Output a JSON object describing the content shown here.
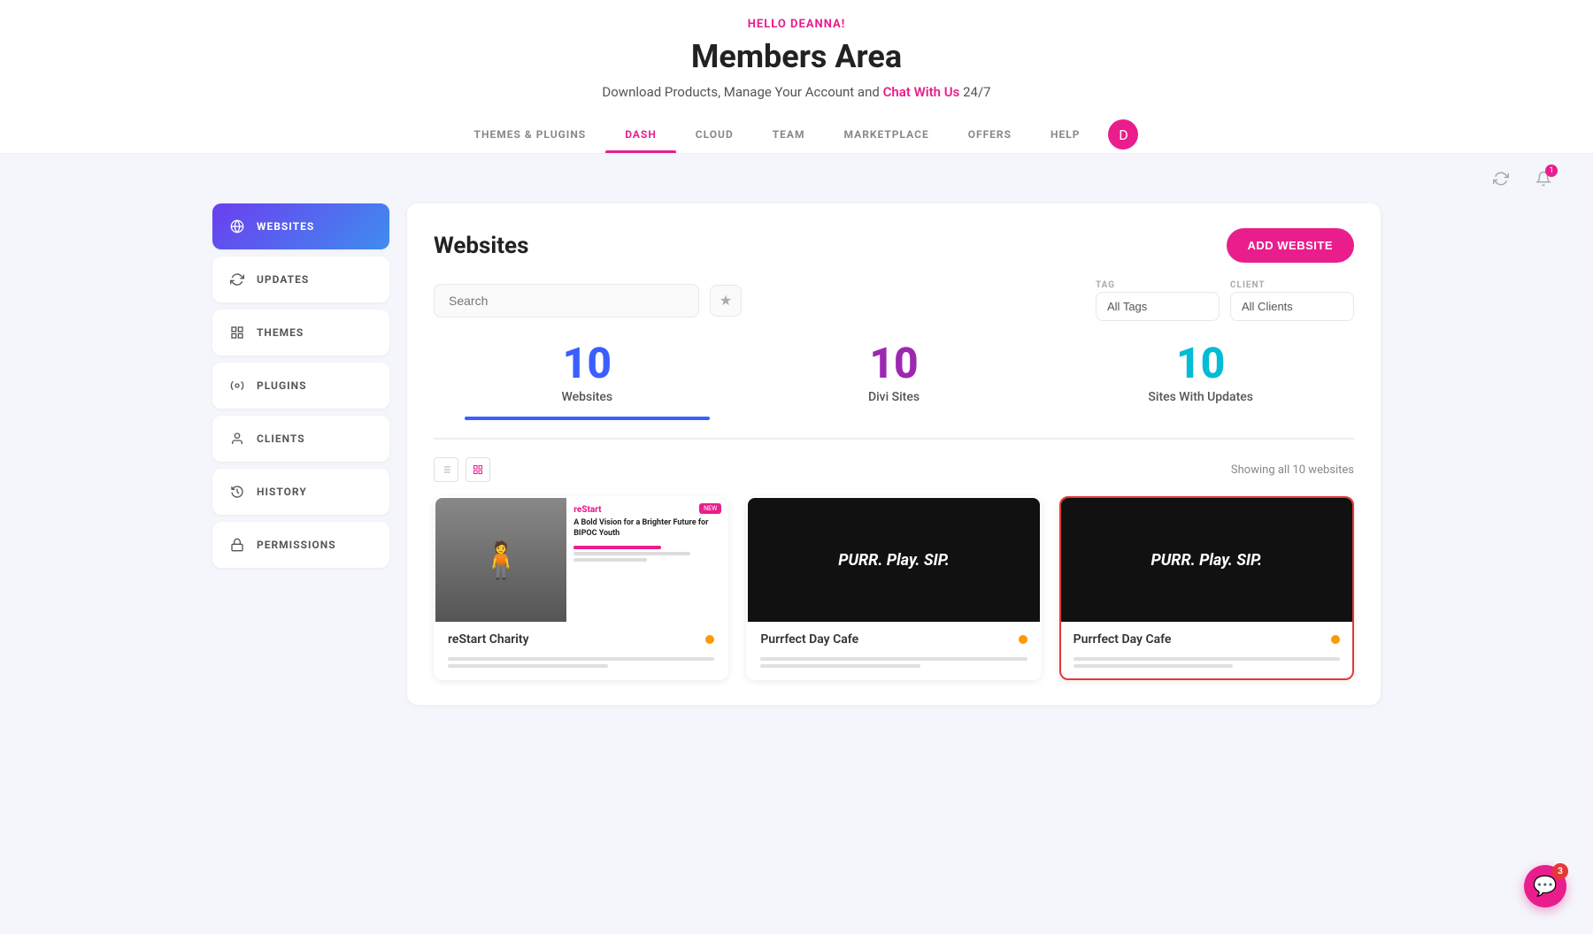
{
  "header": {
    "hello_text": "HELLO DEANNA!",
    "title": "Members Area",
    "subtitle_text": "Download Products, Manage Your Account and",
    "subtitle_link": "Chat With Us",
    "subtitle_suffix": " 24/7"
  },
  "nav": {
    "items": [
      {
        "id": "themes-plugins",
        "label": "THEMES & PLUGINS",
        "active": false
      },
      {
        "id": "dash",
        "label": "DASH",
        "active": true
      },
      {
        "id": "cloud",
        "label": "CLOUD",
        "active": false
      },
      {
        "id": "team",
        "label": "TEAM",
        "active": false
      },
      {
        "id": "marketplace",
        "label": "MARKETPLACE",
        "active": false
      },
      {
        "id": "offers",
        "label": "OFFERS",
        "active": false
      },
      {
        "id": "help",
        "label": "HELP",
        "active": false
      }
    ],
    "avatar_letter": "D"
  },
  "toolbar": {
    "refresh_tooltip": "Refresh",
    "notifications_count": "1"
  },
  "sidebar": {
    "items": [
      {
        "id": "websites",
        "label": "WEBSITES",
        "icon": "globe",
        "active": true
      },
      {
        "id": "updates",
        "label": "UPDATES",
        "icon": "refresh",
        "active": false
      },
      {
        "id": "themes",
        "label": "THEMES",
        "icon": "grid",
        "active": false
      },
      {
        "id": "plugins",
        "label": "PLUGINS",
        "icon": "puzzle",
        "active": false
      },
      {
        "id": "clients",
        "label": "CLIENTS",
        "icon": "person",
        "active": false
      },
      {
        "id": "history",
        "label": "HISTORY",
        "icon": "clock",
        "active": false
      },
      {
        "id": "permissions",
        "label": "PERMISSIONS",
        "icon": "key",
        "active": false
      }
    ]
  },
  "dashboard": {
    "title": "Websites",
    "add_button": "ADD WEBSITE",
    "search_placeholder": "Search",
    "star_tooltip": "Favourites",
    "tag_label": "TAG",
    "tag_default": "All Tags",
    "client_label": "CLIENT",
    "client_default": "All Clients",
    "stats": [
      {
        "number": "10",
        "label": "Websites",
        "color": "blue"
      },
      {
        "number": "10",
        "label": "Divi Sites",
        "color": "purple"
      },
      {
        "number": "10",
        "label": "Sites With Updates",
        "color": "teal"
      }
    ],
    "showing_text": "Showing all 10 websites",
    "websites": [
      {
        "id": "restart",
        "name": "reStart Charity",
        "type": "restart",
        "selected": false
      },
      {
        "id": "purrfect1",
        "name": "Purrfect Day Cafe",
        "type": "purr",
        "selected": false
      },
      {
        "id": "purrfect2",
        "name": "Purrfect Day Cafe",
        "type": "purr",
        "selected": true
      }
    ]
  },
  "chat": {
    "badge": "3",
    "icon": "💬"
  }
}
